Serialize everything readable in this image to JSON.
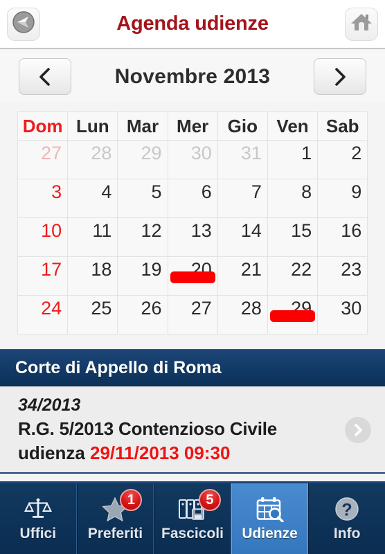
{
  "header": {
    "title": "Agenda udienze",
    "back_icon": "back-compass-icon",
    "home_icon": "home-icon"
  },
  "month_nav": {
    "prev_icon": "chevron-left-icon",
    "next_icon": "chevron-right-icon",
    "label": "Novembre 2013"
  },
  "calendar": {
    "weekdays": [
      "Dom",
      "Lun",
      "Mar",
      "Mer",
      "Gio",
      "Ven",
      "Sab"
    ],
    "weeks": [
      [
        {
          "day": "27",
          "in_month": false,
          "sunday": true,
          "event": false
        },
        {
          "day": "28",
          "in_month": false,
          "sunday": false,
          "event": false
        },
        {
          "day": "29",
          "in_month": false,
          "sunday": false,
          "event": false
        },
        {
          "day": "30",
          "in_month": false,
          "sunday": false,
          "event": false
        },
        {
          "day": "31",
          "in_month": false,
          "sunday": false,
          "event": false
        },
        {
          "day": "1",
          "in_month": true,
          "sunday": false,
          "event": false
        },
        {
          "day": "2",
          "in_month": true,
          "sunday": false,
          "event": false
        }
      ],
      [
        {
          "day": "3",
          "in_month": true,
          "sunday": true,
          "event": false
        },
        {
          "day": "4",
          "in_month": true,
          "sunday": false,
          "event": false
        },
        {
          "day": "5",
          "in_month": true,
          "sunday": false,
          "event": false
        },
        {
          "day": "6",
          "in_month": true,
          "sunday": false,
          "event": false
        },
        {
          "day": "7",
          "in_month": true,
          "sunday": false,
          "event": false
        },
        {
          "day": "8",
          "in_month": true,
          "sunday": false,
          "event": false
        },
        {
          "day": "9",
          "in_month": true,
          "sunday": false,
          "event": false
        }
      ],
      [
        {
          "day": "10",
          "in_month": true,
          "sunday": true,
          "event": false
        },
        {
          "day": "11",
          "in_month": true,
          "sunday": false,
          "event": false
        },
        {
          "day": "12",
          "in_month": true,
          "sunday": false,
          "event": false
        },
        {
          "day": "13",
          "in_month": true,
          "sunday": false,
          "event": false
        },
        {
          "day": "14",
          "in_month": true,
          "sunday": false,
          "event": false
        },
        {
          "day": "15",
          "in_month": true,
          "sunday": false,
          "event": false
        },
        {
          "day": "16",
          "in_month": true,
          "sunday": false,
          "event": false
        }
      ],
      [
        {
          "day": "17",
          "in_month": true,
          "sunday": true,
          "event": false
        },
        {
          "day": "18",
          "in_month": true,
          "sunday": false,
          "event": false
        },
        {
          "day": "19",
          "in_month": true,
          "sunday": false,
          "event": false
        },
        {
          "day": "20",
          "in_month": true,
          "sunday": false,
          "event": true
        },
        {
          "day": "21",
          "in_month": true,
          "sunday": false,
          "event": false
        },
        {
          "day": "22",
          "in_month": true,
          "sunday": false,
          "event": false
        },
        {
          "day": "23",
          "in_month": true,
          "sunday": false,
          "event": false
        }
      ],
      [
        {
          "day": "24",
          "in_month": true,
          "sunday": true,
          "event": false
        },
        {
          "day": "25",
          "in_month": true,
          "sunday": false,
          "event": false
        },
        {
          "day": "26",
          "in_month": true,
          "sunday": false,
          "event": false
        },
        {
          "day": "27",
          "in_month": true,
          "sunday": false,
          "event": false
        },
        {
          "day": "28",
          "in_month": true,
          "sunday": false,
          "event": false
        },
        {
          "day": "29",
          "in_month": true,
          "sunday": false,
          "event": true
        },
        {
          "day": "30",
          "in_month": true,
          "sunday": false,
          "event": false
        }
      ]
    ],
    "event_color": "#fa0000",
    "sunday_color": "#ee1c1c"
  },
  "section": {
    "title": "Corte di Appello di Roma",
    "background_color": "#123a66"
  },
  "hearing": {
    "case_number": "34/2013",
    "description": "R.G. 5/2013 Contenzioso Civile",
    "hearing_label": "udienza ",
    "hearing_datetime": "29/11/2013 09:30",
    "datetime_color": "#ef1414",
    "disclosure_icon": "chevron-right-circle-icon"
  },
  "tabbar": {
    "tabs": [
      {
        "label": "Uffici",
        "icon": "scales-of-justice-icon",
        "badge": null,
        "active": false
      },
      {
        "label": "Preferiti",
        "icon": "star-icon",
        "badge": "1",
        "active": false
      },
      {
        "label": "Fascicoli",
        "icon": "file-folders-icon",
        "badge": "5",
        "active": false
      },
      {
        "label": "Udienze",
        "icon": "calendar-search-icon",
        "badge": null,
        "active": true
      },
      {
        "label": "Info",
        "icon": "question-mark-icon",
        "badge": null,
        "active": false
      }
    ],
    "active_color": "#3577bd",
    "inactive_color": "#0d3159",
    "badge_color": "#d31414"
  }
}
